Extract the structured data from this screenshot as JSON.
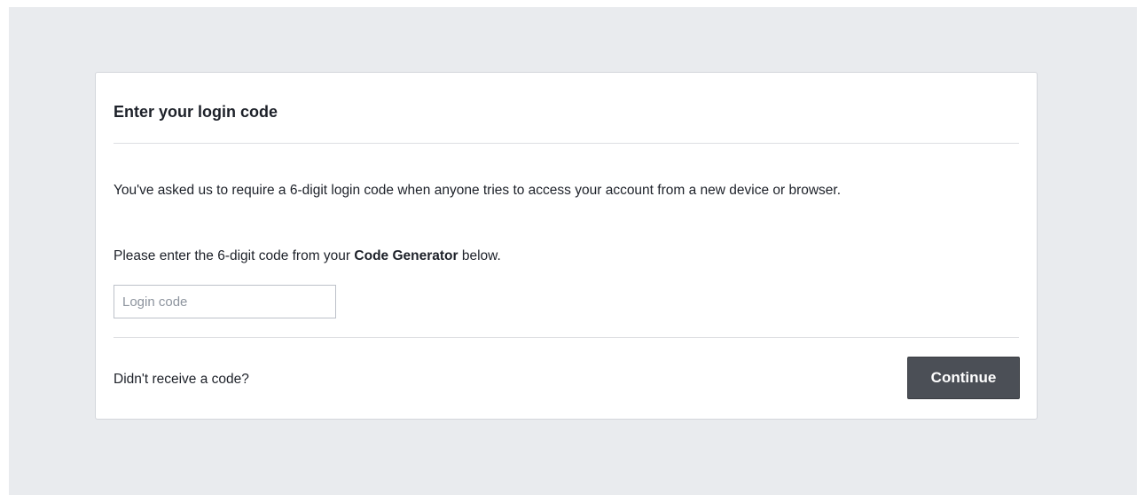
{
  "dialog": {
    "title": "Enter your login code",
    "intro_text": "You've asked us to require a 6-digit login code when anyone tries to access your account from a new device or browser.",
    "instruction_prefix": "Please enter the 6-digit code from your ",
    "instruction_emphasis": "Code Generator",
    "instruction_suffix": " below.",
    "input": {
      "placeholder": "Login code",
      "value": ""
    },
    "resend_link_label": "Didn't receive a code?",
    "continue_label": "Continue"
  },
  "colors": {
    "page_background": "#e9ebee",
    "card_background": "#ffffff",
    "button_background": "#4b4f56",
    "text": "#1d2129"
  }
}
